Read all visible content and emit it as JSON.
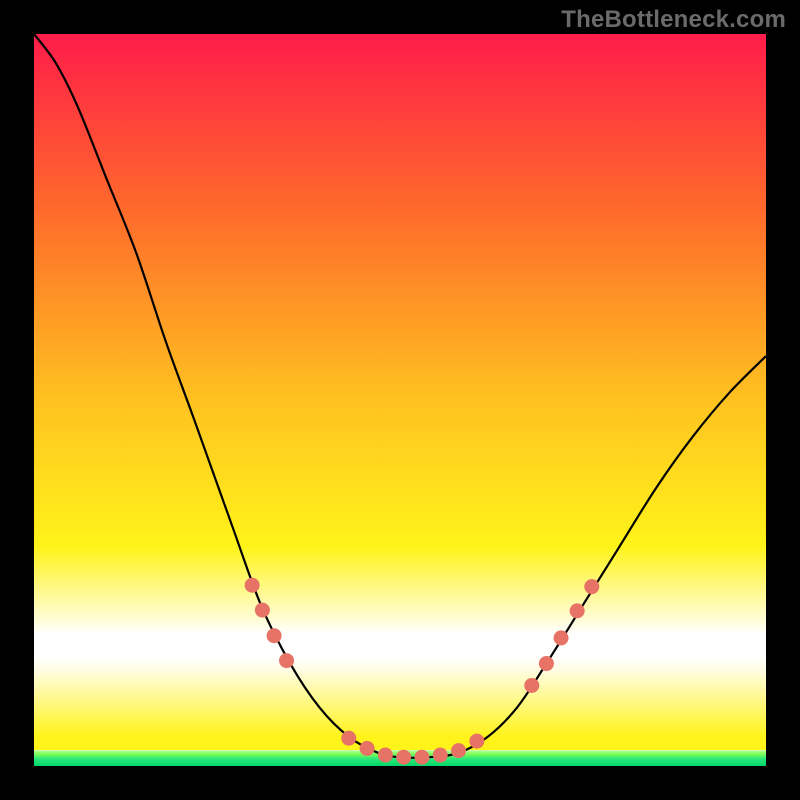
{
  "watermark": "TheBottleneck.com",
  "colors": {
    "frame": "#000000",
    "grad_top": "#ff1c4a",
    "grad_mid_upper": "#ff6a2b",
    "grad_mid": "#ffc220",
    "grad_low": "#fff31a",
    "grad_pale": "#fffde0",
    "white_band": "#ffffff",
    "green_top": "#7cff53",
    "green_bot": "#00d66b",
    "curve": "#000000",
    "dots": "#e77366"
  },
  "chart_data": {
    "type": "line",
    "title": "",
    "xlabel": "",
    "ylabel": "",
    "x_range": [
      0,
      1
    ],
    "y_range": [
      0,
      1
    ],
    "curve": [
      {
        "x": 0.0,
        "y": 1.0
      },
      {
        "x": 0.03,
        "y": 0.96
      },
      {
        "x": 0.06,
        "y": 0.9
      },
      {
        "x": 0.1,
        "y": 0.8
      },
      {
        "x": 0.14,
        "y": 0.7
      },
      {
        "x": 0.18,
        "y": 0.58
      },
      {
        "x": 0.22,
        "y": 0.47
      },
      {
        "x": 0.27,
        "y": 0.33
      },
      {
        "x": 0.31,
        "y": 0.22
      },
      {
        "x": 0.35,
        "y": 0.14
      },
      {
        "x": 0.39,
        "y": 0.08
      },
      {
        "x": 0.43,
        "y": 0.04
      },
      {
        "x": 0.47,
        "y": 0.018
      },
      {
        "x": 0.5,
        "y": 0.012
      },
      {
        "x": 0.54,
        "y": 0.012
      },
      {
        "x": 0.58,
        "y": 0.018
      },
      {
        "x": 0.62,
        "y": 0.04
      },
      {
        "x": 0.66,
        "y": 0.08
      },
      {
        "x": 0.7,
        "y": 0.14
      },
      {
        "x": 0.75,
        "y": 0.22
      },
      {
        "x": 0.8,
        "y": 0.3
      },
      {
        "x": 0.85,
        "y": 0.38
      },
      {
        "x": 0.9,
        "y": 0.45
      },
      {
        "x": 0.95,
        "y": 0.51
      },
      {
        "x": 1.0,
        "y": 0.56
      }
    ],
    "highlight_dots": [
      {
        "x": 0.298,
        "y": 0.247
      },
      {
        "x": 0.312,
        "y": 0.213
      },
      {
        "x": 0.328,
        "y": 0.178
      },
      {
        "x": 0.345,
        "y": 0.144
      },
      {
        "x": 0.43,
        "y": 0.038
      },
      {
        "x": 0.455,
        "y": 0.024
      },
      {
        "x": 0.48,
        "y": 0.015
      },
      {
        "x": 0.505,
        "y": 0.012
      },
      {
        "x": 0.53,
        "y": 0.012
      },
      {
        "x": 0.555,
        "y": 0.015
      },
      {
        "x": 0.58,
        "y": 0.021
      },
      {
        "x": 0.605,
        "y": 0.034
      },
      {
        "x": 0.68,
        "y": 0.11
      },
      {
        "x": 0.7,
        "y": 0.14
      },
      {
        "x": 0.72,
        "y": 0.175
      },
      {
        "x": 0.742,
        "y": 0.212
      },
      {
        "x": 0.762,
        "y": 0.245
      }
    ],
    "bands": {
      "white_band_y": [
        0.17,
        0.225
      ],
      "green_band_y": [
        0.0,
        0.022
      ]
    }
  }
}
